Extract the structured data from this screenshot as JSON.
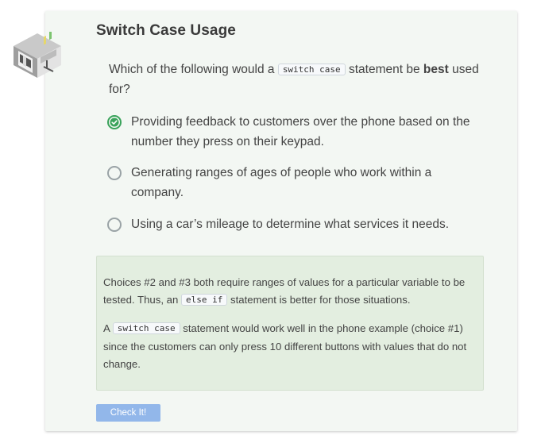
{
  "title": "Switch Case Usage",
  "question": {
    "prefix": "Which of the following would a ",
    "code": "switch case",
    "middle": " statement be ",
    "emphasis": "best",
    "suffix": " used for?"
  },
  "options": [
    {
      "label": "Providing feedback to customers over the phone based on the number they press on their keypad.",
      "selected": true
    },
    {
      "label": "Generating ranges of ages of people who work within a company.",
      "selected": false
    },
    {
      "label": "Using a car’s mileage to determine what services it needs.",
      "selected": false
    }
  ],
  "feedback": {
    "p1_prefix": "Choices #2 and #3 both require ranges of values for a particular variable to be tested. Thus, an ",
    "p1_code": "else if",
    "p1_suffix": " statement is better for those situations.",
    "p2_prefix": "A ",
    "p2_code": "switch case",
    "p2_suffix": " statement would work well in the phone example (choice #1) since the customers can only press 10 different buttons with values that do not change."
  },
  "check_button": "Check It!",
  "colors": {
    "card_bg": "#f3f7f3",
    "feedback_bg": "#e3eee0",
    "selected_green": "#3aa35b",
    "button_blue": "#92b7ea"
  },
  "icons": {
    "logo": "building-isometric-icon",
    "selected": "check-circle-icon",
    "unselected": "radio-empty-icon"
  }
}
